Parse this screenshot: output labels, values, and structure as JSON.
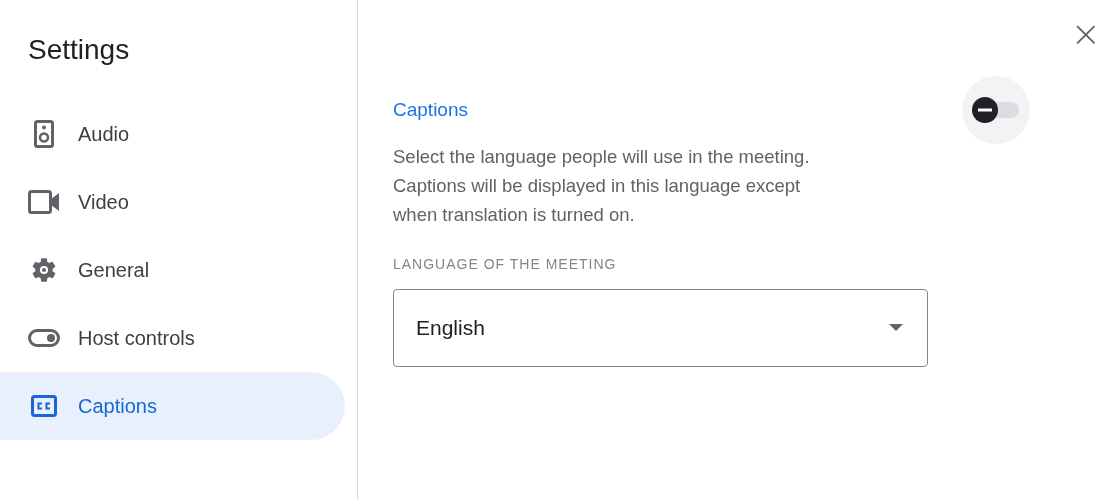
{
  "sidebar": {
    "title": "Settings",
    "items": [
      {
        "label": "Audio",
        "kind": "speaker",
        "selected": false
      },
      {
        "label": "Video",
        "kind": "camera",
        "selected": false
      },
      {
        "label": "General",
        "kind": "gear",
        "selected": false
      },
      {
        "label": "Host controls",
        "kind": "toggle",
        "selected": false
      },
      {
        "label": "Captions",
        "kind": "cc",
        "selected": true
      }
    ]
  },
  "close": "×",
  "captions": {
    "title": "Captions",
    "on": false,
    "description": "Select the language people will use in the meeting. Captions will be displayed in this language except when translation is turned on.",
    "language_label": "LANGUAGE OF THE MEETING",
    "language": "English"
  }
}
